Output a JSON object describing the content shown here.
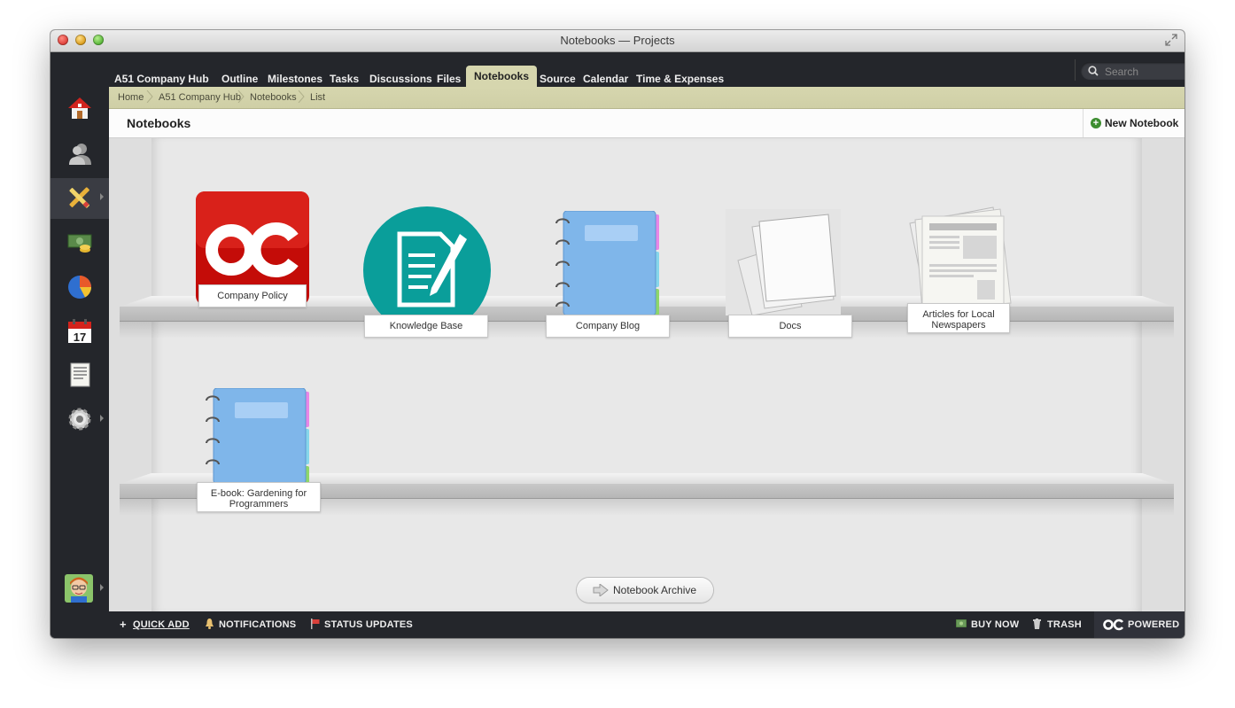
{
  "window": {
    "title": "Notebooks — Projects"
  },
  "topnav": {
    "project": "A51 Company Hub",
    "tabs": [
      "Outline",
      "Milestones",
      "Tasks",
      "Discussions",
      "Files",
      "Notebooks",
      "Source",
      "Calendar",
      "Time & Expenses"
    ],
    "active_tab": "Notebooks"
  },
  "search": {
    "placeholder": "Search"
  },
  "breadcrumb": [
    "Home",
    "A51 Company Hub",
    "Notebooks",
    "List"
  ],
  "page": {
    "title": "Notebooks",
    "new_button": "New Notebook"
  },
  "sidebar": {
    "icons": [
      "home-icon",
      "people-icon",
      "projects-icon",
      "invoices-icon",
      "reports-icon",
      "calendar-icon",
      "documents-icon",
      "settings-icon",
      "user-avatar"
    ],
    "calendar_day": "17"
  },
  "notebooks": [
    {
      "name": "Company Policy",
      "cover": "oc-logo"
    },
    {
      "name": "Knowledge Base",
      "cover": "document-pen"
    },
    {
      "name": "Company Blog",
      "cover": "blue-notebook"
    },
    {
      "name": "Docs",
      "cover": "paper-stack"
    },
    {
      "name": "Articles for Local Newspapers",
      "cover": "newspapers"
    },
    {
      "name": "E-book: Gardening for Programmers",
      "cover": "blue-notebook"
    }
  ],
  "archive": {
    "label": "Notebook Archive"
  },
  "bottombar": {
    "quick_add": "QUICK ADD",
    "notifications": "NOTIFICATIONS",
    "status_updates": "STATUS UPDATES",
    "buy_now": "BUY NOW",
    "trash": "TRASH",
    "powered": "POWERED"
  },
  "colors": {
    "nav_bg": "#24262b",
    "accent": "#d6d6ae",
    "oc_red": "#c00000",
    "teal": "#0a9e9a",
    "notebook_blue": "#7fb6ea"
  }
}
